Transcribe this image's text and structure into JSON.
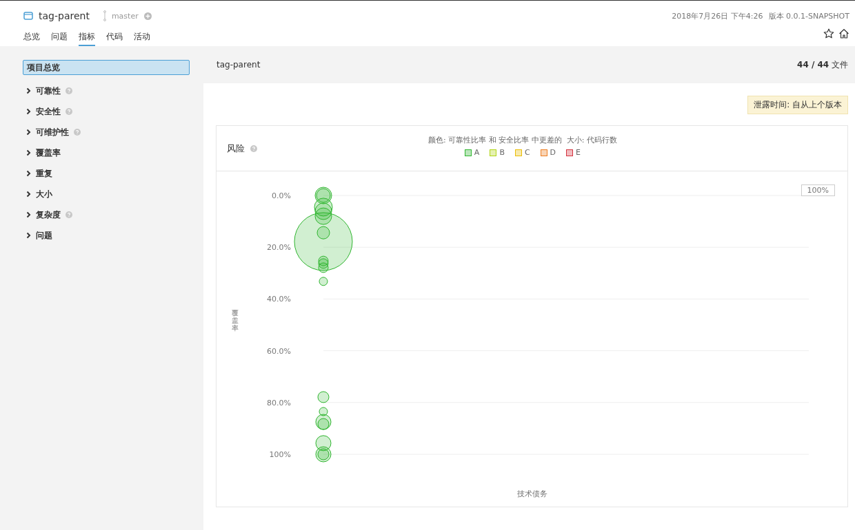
{
  "header": {
    "project": "tag-parent",
    "branch": "master",
    "date": "2018年7月26日 下午4:26",
    "version": "版本 0.0.1-SNAPSHOT"
  },
  "tabs": [
    {
      "label": "总览",
      "selected": false
    },
    {
      "label": "问题",
      "selected": false
    },
    {
      "label": "指标",
      "selected": true
    },
    {
      "label": "代码",
      "selected": false
    },
    {
      "label": "活动",
      "selected": false
    }
  ],
  "sidebar": {
    "items": [
      {
        "label": "项目总览",
        "selected": true,
        "help": false
      },
      {
        "label": "可靠性",
        "selected": false,
        "help": true,
        "expanded": false
      },
      {
        "label": "安全性",
        "selected": false,
        "help": true,
        "expanded": false
      },
      {
        "label": "可维护性",
        "selected": false,
        "help": true,
        "expanded": false
      },
      {
        "label": "覆盖率",
        "selected": false,
        "help": false,
        "expanded": false
      },
      {
        "label": "重复",
        "selected": false,
        "help": false,
        "expanded": false
      },
      {
        "label": "大小",
        "selected": false,
        "help": false,
        "expanded": false
      },
      {
        "label": "复杂度",
        "selected": false,
        "help": true,
        "expanded": false
      },
      {
        "label": "问题",
        "selected": false,
        "help": false,
        "expanded": false
      }
    ]
  },
  "main_header": {
    "title": "tag-parent",
    "files_count": "44 / 44",
    "files_label": "文件"
  },
  "leak_period": "泄露时间: 自从上个版本",
  "risk_card": {
    "title": "风险",
    "legend_title": "颜色: 可靠性比率 和 安全比率 中更差的  大小: 代码行数",
    "legend": [
      {
        "label": "A",
        "color": "#2fb52f"
      },
      {
        "label": "B",
        "color": "#b0d513"
      },
      {
        "label": "C",
        "color": "#eabe06"
      },
      {
        "label": "D",
        "color": "#ed7d20"
      },
      {
        "label": "E",
        "color": "#d4333f"
      }
    ],
    "zoom_button": "100%",
    "chart": {
      "x_axis_label": "技术债务",
      "y_axis_label": "覆盖率",
      "y_tick_labels": [
        "0.0%",
        "20.0%",
        "40.0%",
        "60.0%",
        "80.0%",
        "100%"
      ]
    }
  }
}
